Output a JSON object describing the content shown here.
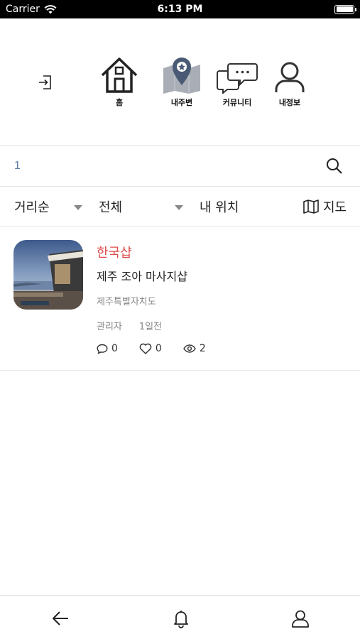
{
  "status_bar": {
    "carrier": "Carrier",
    "time": "6:13 PM"
  },
  "top_nav": {
    "items": [
      {
        "label": "홈",
        "icon": "home-icon"
      },
      {
        "label": "내주변",
        "icon": "map-pin-icon"
      },
      {
        "label": "커뮤니티",
        "icon": "chat-bubbles-icon"
      },
      {
        "label": "내정보",
        "icon": "user-icon"
      }
    ],
    "login_icon": "login-icon"
  },
  "search": {
    "value": "1",
    "icon": "search-icon"
  },
  "filters": {
    "sort": "거리순",
    "category": "전체",
    "location": "내 위치",
    "map": "지도"
  },
  "list": [
    {
      "category": "한국샵",
      "name": "제주 조아 마사지샵",
      "region": "제주특별자치도",
      "author": "관리자",
      "time": "1일전",
      "comments": "0",
      "likes": "0",
      "views": "2"
    }
  ],
  "bottom_bar": {
    "icons": [
      "back-arrow-icon",
      "bell-icon",
      "profile-icon"
    ]
  }
}
